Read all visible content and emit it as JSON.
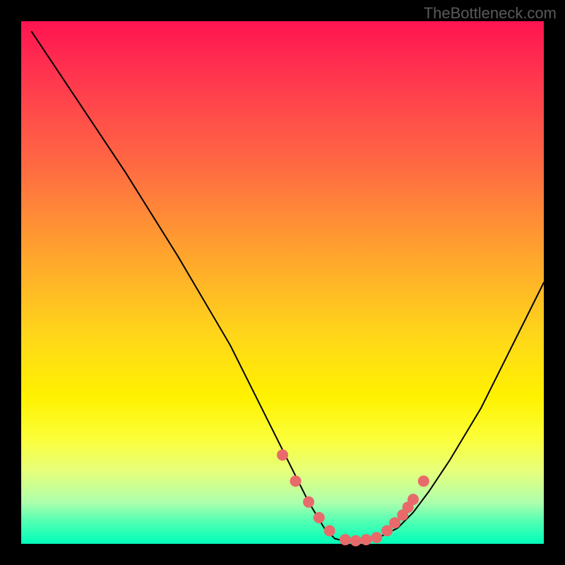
{
  "watermark": "TheBottleneck.com",
  "chart_data": {
    "type": "line",
    "title": "",
    "xlabel": "",
    "ylabel": "",
    "xlim": [
      0,
      100
    ],
    "ylim": [
      0,
      100
    ],
    "grid": false,
    "legend": false,
    "series": [
      {
        "name": "bottleneck-curve",
        "color": "#000000",
        "x": [
          2,
          10,
          20,
          30,
          40,
          48,
          55,
          58,
          60,
          62,
          65,
          68,
          72,
          75,
          78,
          82,
          88,
          95,
          100
        ],
        "y": [
          98,
          86,
          71,
          55,
          38,
          22,
          8,
          3,
          1,
          0.5,
          0.5,
          1,
          3,
          6,
          10,
          16,
          26,
          40,
          50
        ]
      }
    ],
    "markers": {
      "name": "highlight-points",
      "color": "#e86a6a",
      "radius": 8,
      "x": [
        50,
        52.5,
        55,
        57,
        59,
        62,
        64,
        66,
        68,
        70,
        71.5,
        73,
        74,
        75,
        77
      ],
      "y": [
        17,
        12,
        8,
        5,
        2.5,
        0.8,
        0.6,
        0.8,
        1.2,
        2.5,
        4,
        5.5,
        7,
        8.5,
        12
      ]
    },
    "background_gradient": {
      "top": "#ff1451",
      "bottom": "#00ffba"
    }
  }
}
